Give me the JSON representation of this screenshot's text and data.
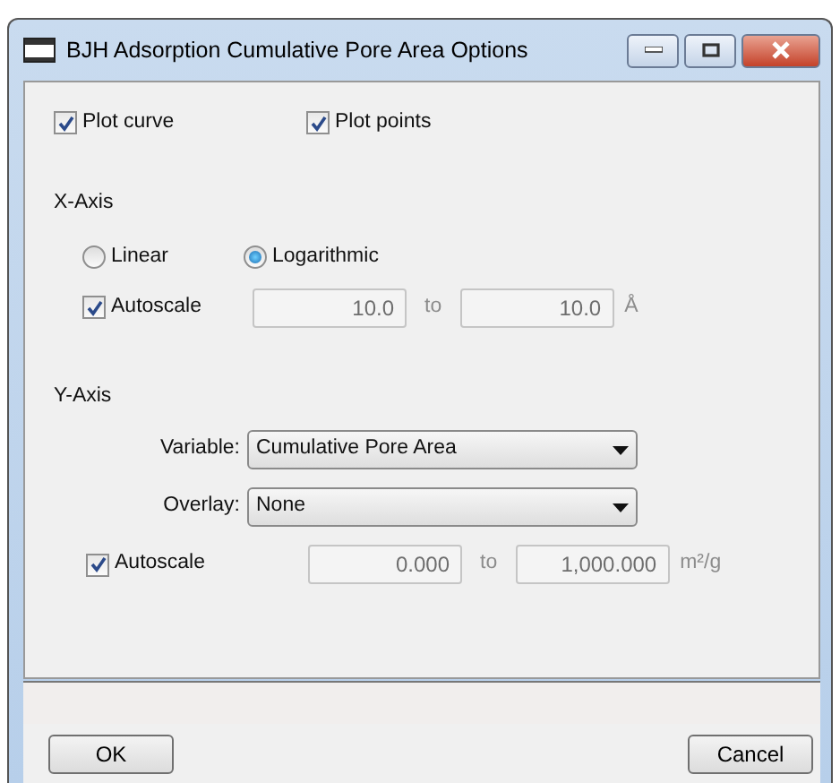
{
  "window": {
    "title": "BJH Adsorption Cumulative Pore Area Options"
  },
  "plot_options": [
    {
      "label": "Plot curve",
      "checked": true
    },
    {
      "label": "Plot points",
      "checked": true
    }
  ],
  "x_axis": {
    "heading": "X-Axis",
    "scale_options": [
      {
        "label": "Linear",
        "selected": false
      },
      {
        "label": "Logarithmic",
        "selected": true
      }
    ],
    "autoscale": {
      "label": "Autoscale",
      "checked": true
    },
    "from": "10.0",
    "to_label": "to",
    "to": "10.0",
    "unit": "Å"
  },
  "y_axis": {
    "heading": "Y-Axis",
    "variable": {
      "label": "Variable:",
      "value": "Cumulative Pore Area"
    },
    "overlay": {
      "label": "Overlay:",
      "value": "None"
    },
    "autoscale": {
      "label": "Autoscale",
      "checked": true
    },
    "from": "0.000",
    "to_label": "to",
    "to": "1,000.000",
    "unit": "m²/g"
  },
  "buttons": [
    {
      "label": "OK"
    },
    {
      "label": "Cancel"
    }
  ]
}
